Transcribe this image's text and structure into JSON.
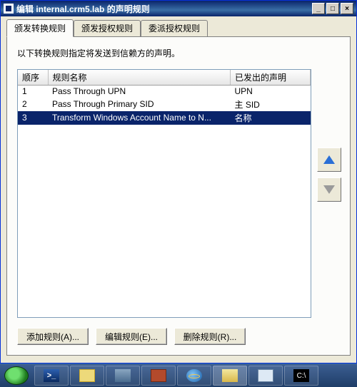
{
  "window": {
    "title": "编辑 internal.crm5.lab 的声明规则"
  },
  "tabs": [
    {
      "label": "颁发转换规则",
      "active": true
    },
    {
      "label": "颁发授权规则",
      "active": false
    },
    {
      "label": "委派授权规则",
      "active": false
    }
  ],
  "description": "以下转换规则指定将发送到信赖方的声明。",
  "columns": {
    "order": "顺序",
    "name": "规则名称",
    "claims": "已发出的声明"
  },
  "rules": [
    {
      "order": "1",
      "name": "Pass Through UPN",
      "claims": "UPN",
      "selected": false
    },
    {
      "order": "2",
      "name": "Pass Through Primary SID",
      "claims": "主 SID",
      "selected": false
    },
    {
      "order": "3",
      "name": "Transform Windows Account Name to N...",
      "claims": "名称",
      "selected": true
    }
  ],
  "buttons": {
    "add": "添加规则(A)...",
    "edit": "编辑规则(E)...",
    "remove": "删除规则(R)..."
  },
  "taskbar": {
    "start": "",
    "items": [
      {
        "name": "powershell",
        "icon": "ic-ps",
        "text": ">_",
        "active": false
      },
      {
        "name": "explorer",
        "icon": "ic-explorer",
        "text": "",
        "active": false
      },
      {
        "name": "server-manager",
        "icon": "ic-server",
        "text": "",
        "active": false
      },
      {
        "name": "toolbox",
        "icon": "ic-toolbox",
        "text": "",
        "active": false
      },
      {
        "name": "internet-explorer",
        "icon": "ic-ie",
        "text": "",
        "active": false
      },
      {
        "name": "adfs-manager",
        "icon": "ic-mgr",
        "text": "",
        "active": true
      },
      {
        "name": "network",
        "icon": "ic-net",
        "text": "",
        "active": false
      },
      {
        "name": "command-prompt",
        "icon": "ic-cmd",
        "text": "C:\\",
        "active": false
      }
    ]
  }
}
